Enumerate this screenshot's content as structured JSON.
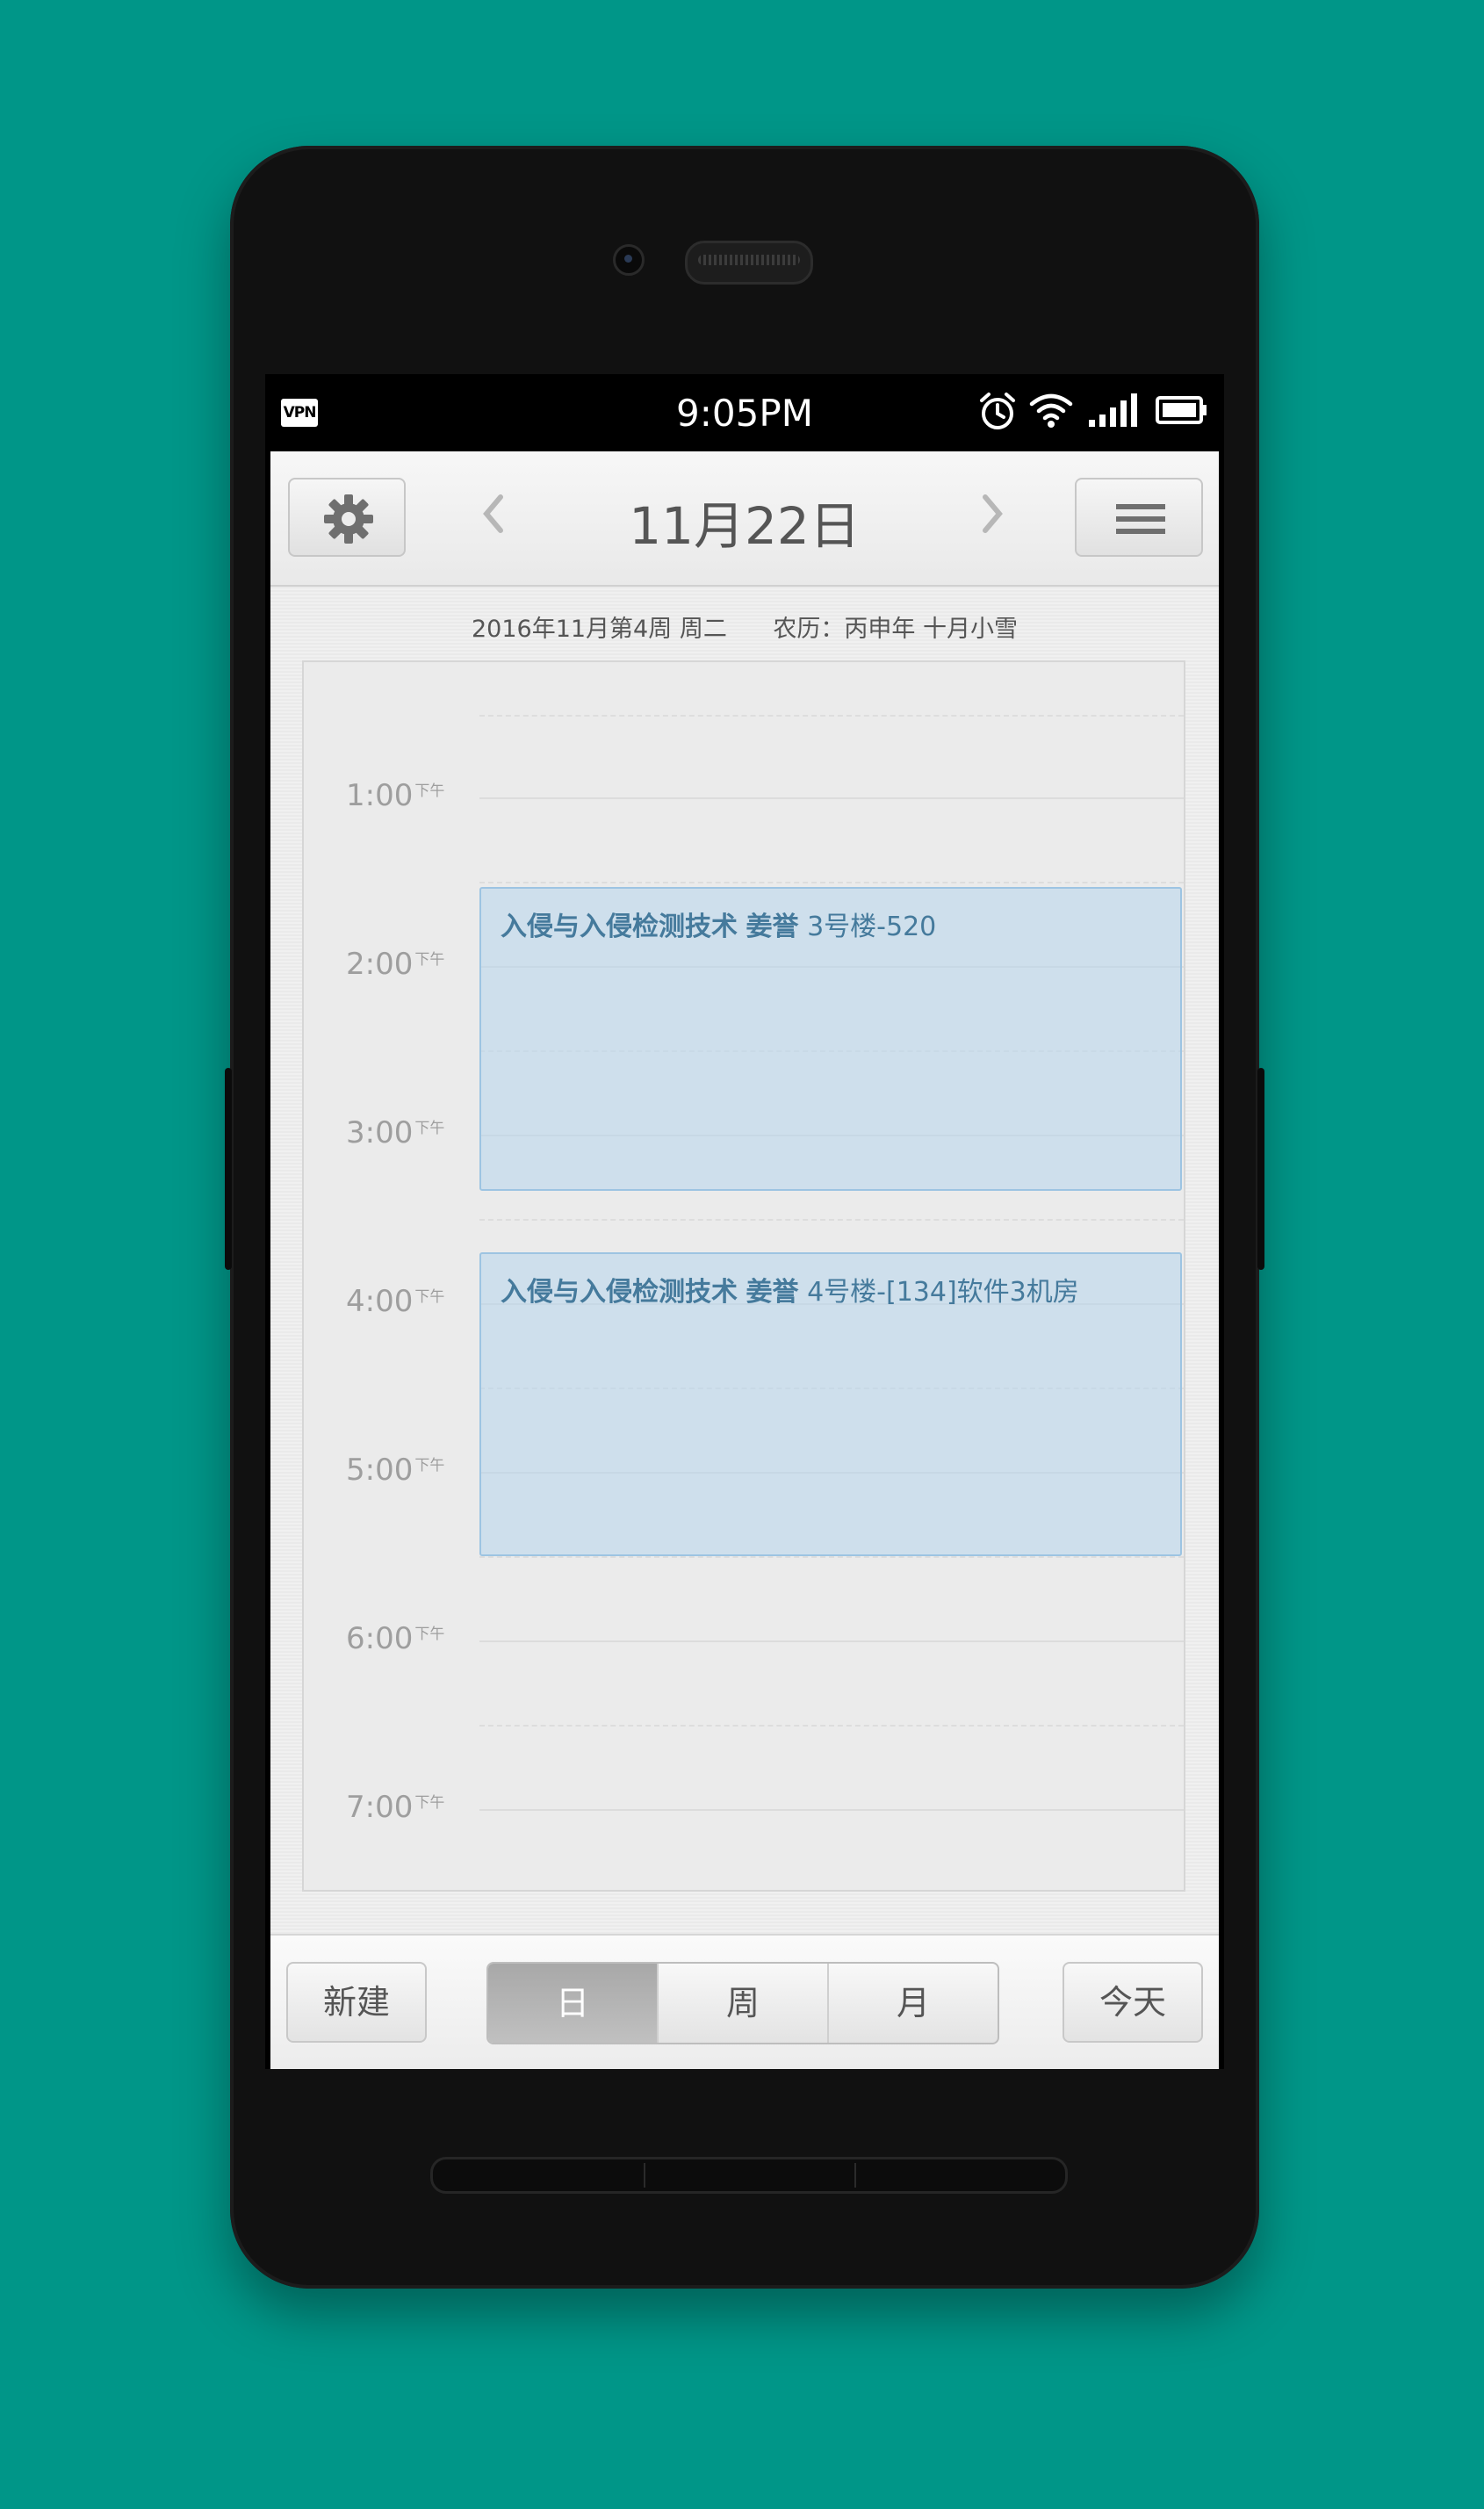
{
  "status_bar": {
    "vpn": "VPN",
    "time": "9:05PM",
    "icons": [
      "alarm-icon",
      "wifi-icon",
      "signal-icon",
      "battery-icon"
    ]
  },
  "header": {
    "title": "11月22日",
    "settings_icon": "gear-icon",
    "prev_icon": "chevron-left-icon",
    "next_icon": "chevron-right-icon",
    "menu_icon": "menu-icon"
  },
  "subheader": {
    "week_info": "2016年11月第4周 周二",
    "lunar": "农历：丙申年 十月小雪"
  },
  "timeline": {
    "hours": [
      {
        "time": "1:00",
        "ampm": "下午"
      },
      {
        "time": "2:00",
        "ampm": "下午"
      },
      {
        "time": "3:00",
        "ampm": "下午"
      },
      {
        "time": "4:00",
        "ampm": "下午"
      },
      {
        "time": "5:00",
        "ampm": "下午"
      },
      {
        "time": "6:00",
        "ampm": "下午"
      },
      {
        "time": "7:00",
        "ampm": "下午"
      }
    ],
    "events": [
      {
        "name": "入侵与入侵检测技术",
        "teacher": "姜誉",
        "location": "3号楼-520"
      },
      {
        "name": "入侵与入侵检测技术",
        "teacher": "姜誉",
        "location": "4号楼-[134]软件3机房"
      }
    ]
  },
  "bottom_bar": {
    "new_label": "新建",
    "views": [
      "日",
      "周",
      "月"
    ],
    "active_view": "日",
    "today_label": "今天"
  },
  "colors": {
    "background": "#009688",
    "event_fill": "#cfe2f1",
    "event_text": "#457a9c"
  }
}
